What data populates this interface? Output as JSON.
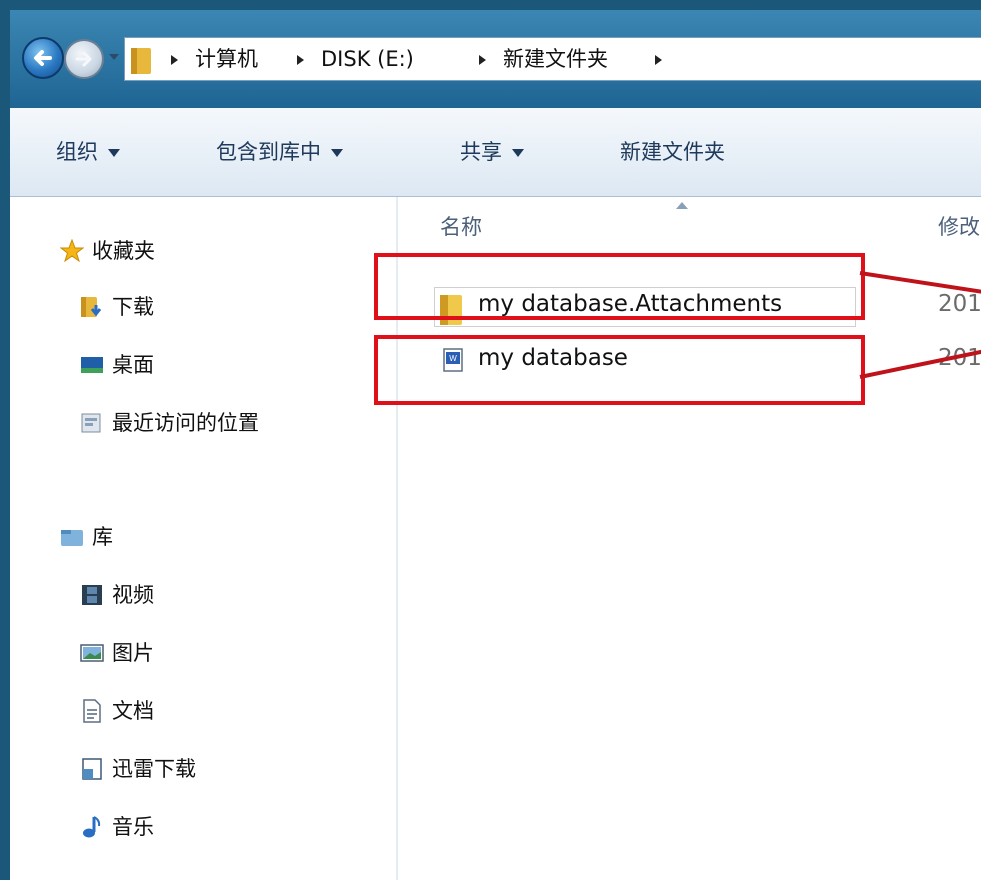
{
  "address": {
    "crumbs": [
      "计算机",
      "DISK (E:)",
      "新建文件夹"
    ]
  },
  "toolbar": {
    "organize": "组织",
    "include_in_library": "包含到库中",
    "share": "共享",
    "new_folder": "新建文件夹"
  },
  "nav": {
    "favorites": {
      "header": "收藏夹",
      "items": [
        "下载",
        "桌面",
        "最近访问的位置"
      ]
    },
    "libraries": {
      "header": "库",
      "items": [
        "视频",
        "图片",
        "文档",
        "迅雷下载",
        "音乐"
      ]
    }
  },
  "columns": {
    "name": "名称",
    "modified": "修改"
  },
  "files": [
    {
      "name": "my database.Attachments",
      "date_partial": "201",
      "type": "folder"
    },
    {
      "name": "my database",
      "date_partial": "201",
      "type": "document"
    }
  ],
  "annotation": {
    "color": "#e0101a"
  }
}
